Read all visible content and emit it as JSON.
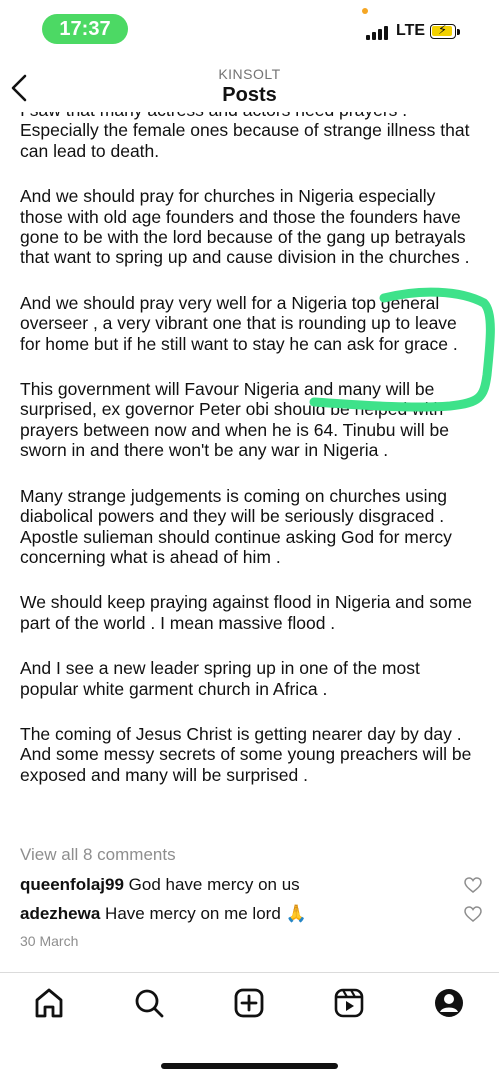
{
  "status": {
    "time": "17:37",
    "network": "LTE"
  },
  "header": {
    "username": "KINSOLT",
    "title": "Posts"
  },
  "caption": {
    "paragraphs": [
      "I saw that many actress and actors need prayers . Especially the female ones because of strange illness that can lead to death.",
      "And we should pray for churches in Nigeria especially those with old age founders and those the founders have gone to be with the lord because of the gang up betrayals that want to spring up and cause division in the churches .",
      "And we should pray very well for a Nigeria top general overseer , a very vibrant one that is rounding up to leave for home but if he still want to stay he can ask for grace .",
      "This government will Favour Nigeria and many will be surprised, ex governor Peter obi should be helped with prayers between now and when he is 64.  Tinubu will be sworn in and there won't be any war in Nigeria .",
      "Many strange judgements is coming on churches using diabolical powers and they will be seriously disgraced . Apostle sulieman should continue asking God for mercy concerning what is ahead of him .",
      "We should keep praying against flood in Nigeria and some part of the world .  I mean massive flood .",
      "And I see a new leader spring up in one of the most popular white garment church in Africa .",
      "The coming of Jesus Christ is getting nearer day by day .  And some messy secrets of some young preachers will be exposed and many will be surprised ."
    ]
  },
  "comments": {
    "view_all": "View all 8 comments",
    "items": [
      {
        "user": "queenfolaj99",
        "text": "God have mercy on us"
      },
      {
        "user": "adezhewa",
        "text": "Have mercy on me lord 🙏"
      }
    ]
  },
  "post_date": "30 March",
  "icons": {
    "back": "chevron-left-icon",
    "home": "home-icon",
    "search": "search-icon",
    "create": "plus-square-icon",
    "reels": "reels-icon",
    "profile": "profile-icon",
    "heart": "heart-outline-icon"
  },
  "colors": {
    "highlight": "#3ee28a",
    "time_pill": "#4cd964",
    "battery": "#f3d100"
  }
}
